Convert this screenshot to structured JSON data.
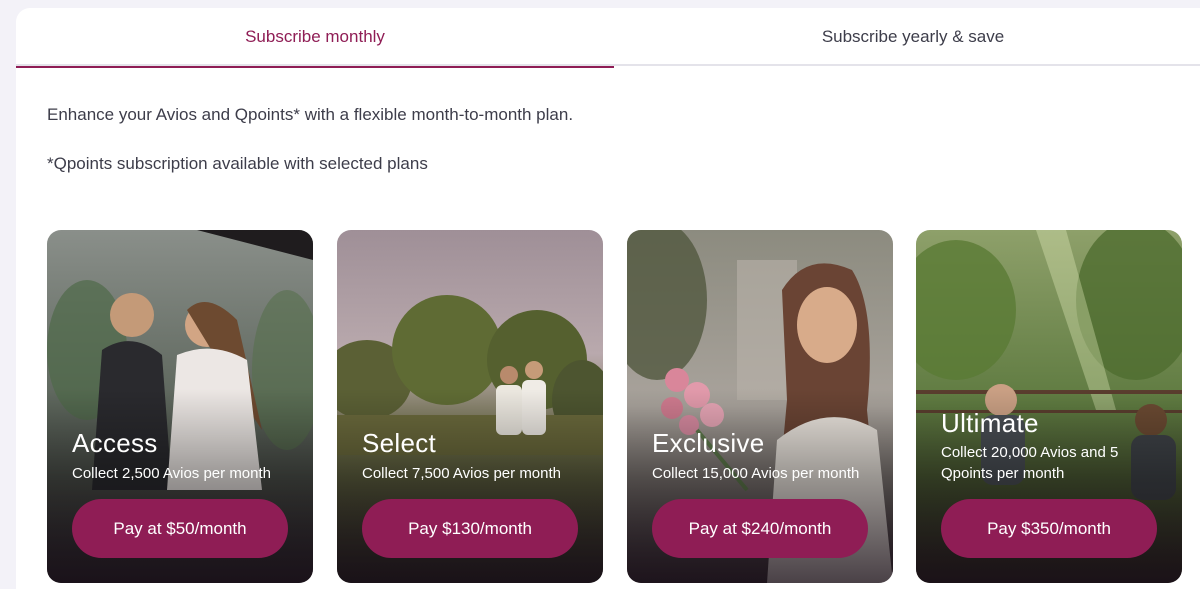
{
  "tabs": [
    {
      "label": "Subscribe monthly",
      "active": true
    },
    {
      "label": "Subscribe yearly & save",
      "active": false
    }
  ],
  "intro": "Enhance your Avios and Qpoints* with a flexible month-to-month plan.",
  "note": "*Qpoints subscription available with selected plans",
  "plans": [
    {
      "name": "Access",
      "description": "Collect 2,500 Avios per month",
      "button": "Pay at $50/month"
    },
    {
      "name": "Select",
      "description": "Collect 7,500 Avios per month",
      "button": "Pay $130/month"
    },
    {
      "name": "Exclusive",
      "description": "Collect 15,000 Avios per month",
      "button": "Pay at $240/month"
    },
    {
      "name": "Ultimate",
      "description": "Collect 20,000 Avios and 5 Qpoints per month",
      "button": "Pay $350/month"
    }
  ],
  "colors": {
    "accent": "#8f1d55",
    "text": "#3d3d4a",
    "background": "#f3f2f8"
  }
}
